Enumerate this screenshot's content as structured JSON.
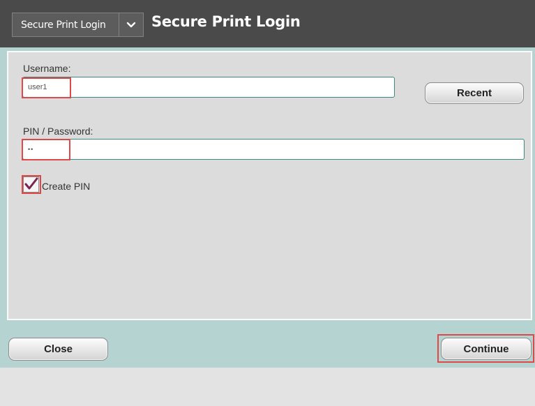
{
  "header": {
    "app_selector_label": "Secure Print Login",
    "title": "Secure Print Login"
  },
  "form": {
    "username_label": "Username:",
    "username_value": "user1",
    "recent_button": "Recent",
    "password_label": "PIN / Password:",
    "password_value": "••",
    "create_pin_label": "Create PIN",
    "create_pin_checked": true
  },
  "footer": {
    "close_button": "Close",
    "continue_button": "Continue"
  },
  "colors": {
    "title_bar": "#4a4a4a",
    "teal_band": "#b4d3d1",
    "panel": "#dcdcdc",
    "field_border": "#3c8a82",
    "highlight": "#e04848",
    "checkmark": "#7a2450"
  },
  "icons": {
    "selector_chevron": "chevron-down-icon",
    "checkbox_mark": "checkmark-icon"
  }
}
